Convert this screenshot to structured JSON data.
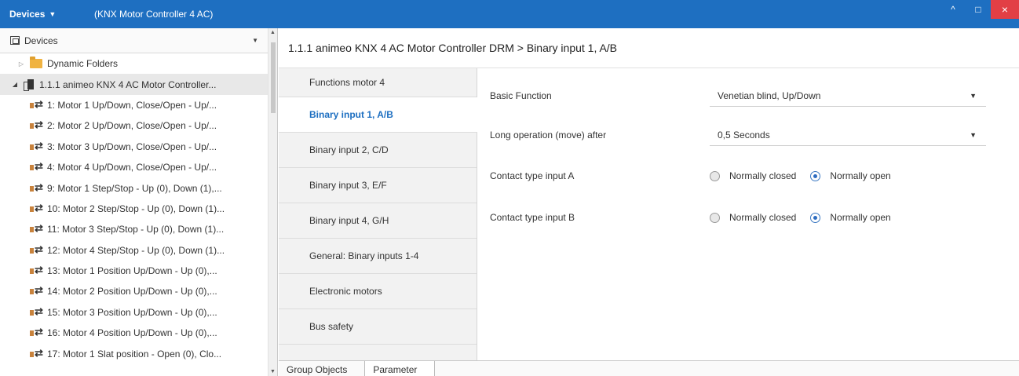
{
  "titlebar": {
    "menu_label": "Devices",
    "window_title": "(KNX Motor Controller 4 AC)",
    "controls": [
      "^",
      "□",
      "×"
    ]
  },
  "left": {
    "header_label": "Devices",
    "tree": [
      {
        "label": "Dynamic Folders",
        "type": "folder",
        "level": 0
      },
      {
        "label": "1.1.1 animeo KNX 4 AC Motor Controller...",
        "type": "device",
        "level": 0
      },
      {
        "label": "1: Motor 1 Up/Down, Close/Open - Up/...",
        "type": "go",
        "level": 1
      },
      {
        "label": "2: Motor 2 Up/Down, Close/Open - Up/...",
        "type": "go",
        "level": 1
      },
      {
        "label": "3: Motor 3 Up/Down, Close/Open - Up/...",
        "type": "go",
        "level": 1
      },
      {
        "label": "4: Motor 4 Up/Down, Close/Open - Up/...",
        "type": "go",
        "level": 1
      },
      {
        "label": "9: Motor 1 Step/Stop - Up (0), Down (1),...",
        "type": "go",
        "level": 1
      },
      {
        "label": "10: Motor 2 Step/Stop - Up (0), Down (1)...",
        "type": "go",
        "level": 1
      },
      {
        "label": "11: Motor 3 Step/Stop - Up (0), Down (1)...",
        "type": "go",
        "level": 1
      },
      {
        "label": "12: Motor 4 Step/Stop - Up (0), Down (1)...",
        "type": "go",
        "level": 1
      },
      {
        "label": "13: Motor 1 Position Up/Down - Up (0),...",
        "type": "go",
        "level": 1
      },
      {
        "label": "14: Motor 2 Position Up/Down - Up (0),...",
        "type": "go",
        "level": 1
      },
      {
        "label": "15: Motor 3 Position Up/Down - Up (0),...",
        "type": "go",
        "level": 1
      },
      {
        "label": "16: Motor 4 Position Up/Down - Up (0),...",
        "type": "go",
        "level": 1
      },
      {
        "label": "17: Motor 1 Slat position - Open (0), Clo...",
        "type": "go",
        "level": 1
      }
    ]
  },
  "main": {
    "breadcrumb": "1.1.1 animeo KNX 4 AC Motor Controller DRM > Binary input 1, A/B",
    "param_tabs": [
      "Functions motor 4",
      "Binary input 1, A/B",
      "Binary input 2, C/D",
      "Binary input 3, E/F",
      "Binary input 4, G/H",
      "General: Binary inputs 1-4",
      "Electronic motors",
      "Bus safety"
    ],
    "active_tab": "Binary input 1, A/B",
    "params": {
      "basic_function": {
        "label": "Basic Function",
        "value": "Venetian blind, Up/Down"
      },
      "long_operation": {
        "label": "Long operation (move) after",
        "value": "0,5 Seconds"
      },
      "contact_a": {
        "label": "Contact type input A",
        "options": [
          "Normally closed",
          "Normally open"
        ],
        "selected": "Normally open"
      },
      "contact_b": {
        "label": "Contact type input B",
        "options": [
          "Normally closed",
          "Normally open"
        ],
        "selected": "Normally open"
      }
    },
    "bottom_tabs": [
      "Group Objects",
      "Parameter"
    ],
    "active_bottom_tab": "Parameter"
  },
  "colors": {
    "titlebar": "#1e6fc1",
    "accent": "#1d6fc1",
    "close": "#e23f45"
  }
}
